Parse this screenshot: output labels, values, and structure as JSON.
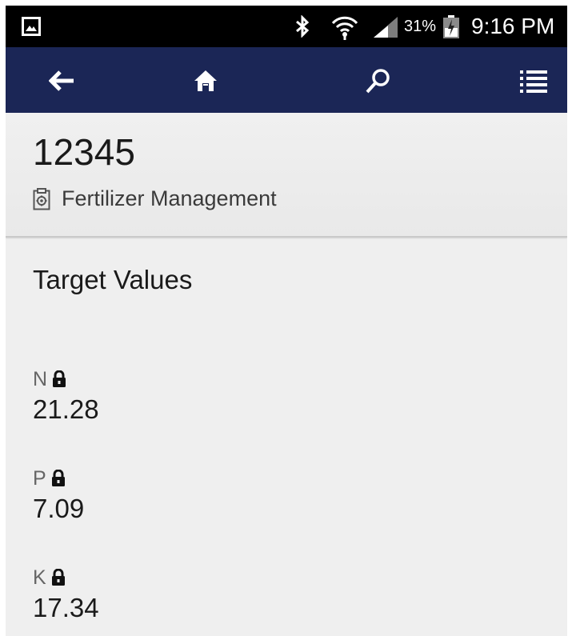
{
  "status_bar": {
    "battery_percent": "31%",
    "time": "9:16 PM",
    "icons": [
      "gallery-icon",
      "bluetooth-icon",
      "wifi-icon",
      "signal-icon",
      "battery-icon"
    ]
  },
  "nav": {
    "icons": [
      "back-arrow-icon",
      "home-icon",
      "search-icon",
      "list-menu-icon"
    ],
    "accent_color": "#1b2656"
  },
  "header": {
    "record_id": "12345",
    "module_icon": "clipboard-gear-icon",
    "module_label": "Fertilizer Management"
  },
  "content": {
    "section_title": "Target Values",
    "fields": [
      {
        "label": "N",
        "value": "21.28",
        "locked": true,
        "icon": "lock-icon"
      },
      {
        "label": "P",
        "value": "7.09",
        "locked": true,
        "icon": "lock-icon"
      },
      {
        "label": "K",
        "value": "17.34",
        "locked": true,
        "icon": "lock-icon"
      }
    ]
  }
}
